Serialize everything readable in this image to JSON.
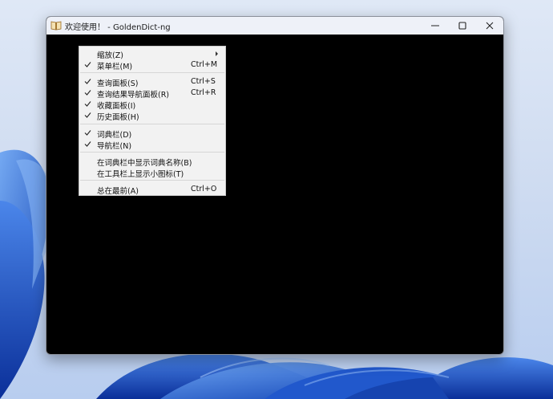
{
  "window": {
    "title": "欢迎使用！ - GoldenDict-ng"
  },
  "menu": {
    "items": [
      {
        "label": "缩放(Z)",
        "shortcut": "",
        "checked": false,
        "submenu": true
      },
      {
        "label": "菜单栏(M)",
        "shortcut": "Ctrl+M",
        "checked": true,
        "submenu": false
      },
      {
        "label": "查询面板(S)",
        "shortcut": "Ctrl+S",
        "checked": true,
        "submenu": false
      },
      {
        "label": "查询结果导航面板(R)",
        "shortcut": "Ctrl+R",
        "checked": true,
        "submenu": false
      },
      {
        "label": "收藏面板(I)",
        "shortcut": "",
        "checked": true,
        "submenu": false
      },
      {
        "label": "历史面板(H)",
        "shortcut": "",
        "checked": true,
        "submenu": false
      },
      {
        "label": "词典栏(D)",
        "shortcut": "",
        "checked": true,
        "submenu": false
      },
      {
        "label": "导航栏(N)",
        "shortcut": "",
        "checked": true,
        "submenu": false
      },
      {
        "label": "在词典栏中显示词典名称(B)",
        "shortcut": "",
        "checked": false,
        "submenu": false
      },
      {
        "label": "在工具栏上显示小图标(T)",
        "shortcut": "",
        "checked": false,
        "submenu": false
      },
      {
        "label": "总在最前(A)",
        "shortcut": "Ctrl+O",
        "checked": false,
        "submenu": false
      }
    ]
  },
  "colors": {
    "content_bg": "#000000",
    "titlebar_bg": "#eef1f8",
    "menu_bg": "#f2f2f2",
    "wallpaper_blue": "#1f5fd6"
  }
}
